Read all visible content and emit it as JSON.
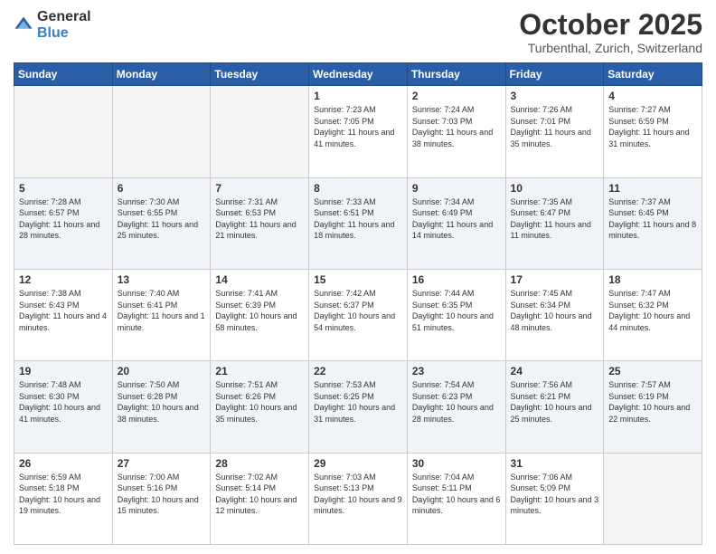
{
  "header": {
    "logo_general": "General",
    "logo_blue": "Blue",
    "month_title": "October 2025",
    "location": "Turbenthal, Zurich, Switzerland"
  },
  "weekdays": [
    "Sunday",
    "Monday",
    "Tuesday",
    "Wednesday",
    "Thursday",
    "Friday",
    "Saturday"
  ],
  "weeks": [
    [
      {
        "day": "",
        "sunrise": "",
        "sunset": "",
        "daylight": ""
      },
      {
        "day": "",
        "sunrise": "",
        "sunset": "",
        "daylight": ""
      },
      {
        "day": "",
        "sunrise": "",
        "sunset": "",
        "daylight": ""
      },
      {
        "day": "1",
        "sunrise": "Sunrise: 7:23 AM",
        "sunset": "Sunset: 7:05 PM",
        "daylight": "Daylight: 11 hours and 41 minutes."
      },
      {
        "day": "2",
        "sunrise": "Sunrise: 7:24 AM",
        "sunset": "Sunset: 7:03 PM",
        "daylight": "Daylight: 11 hours and 38 minutes."
      },
      {
        "day": "3",
        "sunrise": "Sunrise: 7:26 AM",
        "sunset": "Sunset: 7:01 PM",
        "daylight": "Daylight: 11 hours and 35 minutes."
      },
      {
        "day": "4",
        "sunrise": "Sunrise: 7:27 AM",
        "sunset": "Sunset: 6:59 PM",
        "daylight": "Daylight: 11 hours and 31 minutes."
      }
    ],
    [
      {
        "day": "5",
        "sunrise": "Sunrise: 7:28 AM",
        "sunset": "Sunset: 6:57 PM",
        "daylight": "Daylight: 11 hours and 28 minutes."
      },
      {
        "day": "6",
        "sunrise": "Sunrise: 7:30 AM",
        "sunset": "Sunset: 6:55 PM",
        "daylight": "Daylight: 11 hours and 25 minutes."
      },
      {
        "day": "7",
        "sunrise": "Sunrise: 7:31 AM",
        "sunset": "Sunset: 6:53 PM",
        "daylight": "Daylight: 11 hours and 21 minutes."
      },
      {
        "day": "8",
        "sunrise": "Sunrise: 7:33 AM",
        "sunset": "Sunset: 6:51 PM",
        "daylight": "Daylight: 11 hours and 18 minutes."
      },
      {
        "day": "9",
        "sunrise": "Sunrise: 7:34 AM",
        "sunset": "Sunset: 6:49 PM",
        "daylight": "Daylight: 11 hours and 14 minutes."
      },
      {
        "day": "10",
        "sunrise": "Sunrise: 7:35 AM",
        "sunset": "Sunset: 6:47 PM",
        "daylight": "Daylight: 11 hours and 11 minutes."
      },
      {
        "day": "11",
        "sunrise": "Sunrise: 7:37 AM",
        "sunset": "Sunset: 6:45 PM",
        "daylight": "Daylight: 11 hours and 8 minutes."
      }
    ],
    [
      {
        "day": "12",
        "sunrise": "Sunrise: 7:38 AM",
        "sunset": "Sunset: 6:43 PM",
        "daylight": "Daylight: 11 hours and 4 minutes."
      },
      {
        "day": "13",
        "sunrise": "Sunrise: 7:40 AM",
        "sunset": "Sunset: 6:41 PM",
        "daylight": "Daylight: 11 hours and 1 minute."
      },
      {
        "day": "14",
        "sunrise": "Sunrise: 7:41 AM",
        "sunset": "Sunset: 6:39 PM",
        "daylight": "Daylight: 10 hours and 58 minutes."
      },
      {
        "day": "15",
        "sunrise": "Sunrise: 7:42 AM",
        "sunset": "Sunset: 6:37 PM",
        "daylight": "Daylight: 10 hours and 54 minutes."
      },
      {
        "day": "16",
        "sunrise": "Sunrise: 7:44 AM",
        "sunset": "Sunset: 6:35 PM",
        "daylight": "Daylight: 10 hours and 51 minutes."
      },
      {
        "day": "17",
        "sunrise": "Sunrise: 7:45 AM",
        "sunset": "Sunset: 6:34 PM",
        "daylight": "Daylight: 10 hours and 48 minutes."
      },
      {
        "day": "18",
        "sunrise": "Sunrise: 7:47 AM",
        "sunset": "Sunset: 6:32 PM",
        "daylight": "Daylight: 10 hours and 44 minutes."
      }
    ],
    [
      {
        "day": "19",
        "sunrise": "Sunrise: 7:48 AM",
        "sunset": "Sunset: 6:30 PM",
        "daylight": "Daylight: 10 hours and 41 minutes."
      },
      {
        "day": "20",
        "sunrise": "Sunrise: 7:50 AM",
        "sunset": "Sunset: 6:28 PM",
        "daylight": "Daylight: 10 hours and 38 minutes."
      },
      {
        "day": "21",
        "sunrise": "Sunrise: 7:51 AM",
        "sunset": "Sunset: 6:26 PM",
        "daylight": "Daylight: 10 hours and 35 minutes."
      },
      {
        "day": "22",
        "sunrise": "Sunrise: 7:53 AM",
        "sunset": "Sunset: 6:25 PM",
        "daylight": "Daylight: 10 hours and 31 minutes."
      },
      {
        "day": "23",
        "sunrise": "Sunrise: 7:54 AM",
        "sunset": "Sunset: 6:23 PM",
        "daylight": "Daylight: 10 hours and 28 minutes."
      },
      {
        "day": "24",
        "sunrise": "Sunrise: 7:56 AM",
        "sunset": "Sunset: 6:21 PM",
        "daylight": "Daylight: 10 hours and 25 minutes."
      },
      {
        "day": "25",
        "sunrise": "Sunrise: 7:57 AM",
        "sunset": "Sunset: 6:19 PM",
        "daylight": "Daylight: 10 hours and 22 minutes."
      }
    ],
    [
      {
        "day": "26",
        "sunrise": "Sunrise: 6:59 AM",
        "sunset": "Sunset: 5:18 PM",
        "daylight": "Daylight: 10 hours and 19 minutes."
      },
      {
        "day": "27",
        "sunrise": "Sunrise: 7:00 AM",
        "sunset": "Sunset: 5:16 PM",
        "daylight": "Daylight: 10 hours and 15 minutes."
      },
      {
        "day": "28",
        "sunrise": "Sunrise: 7:02 AM",
        "sunset": "Sunset: 5:14 PM",
        "daylight": "Daylight: 10 hours and 12 minutes."
      },
      {
        "day": "29",
        "sunrise": "Sunrise: 7:03 AM",
        "sunset": "Sunset: 5:13 PM",
        "daylight": "Daylight: 10 hours and 9 minutes."
      },
      {
        "day": "30",
        "sunrise": "Sunrise: 7:04 AM",
        "sunset": "Sunset: 5:11 PM",
        "daylight": "Daylight: 10 hours and 6 minutes."
      },
      {
        "day": "31",
        "sunrise": "Sunrise: 7:06 AM",
        "sunset": "Sunset: 5:09 PM",
        "daylight": "Daylight: 10 hours and 3 minutes."
      },
      {
        "day": "",
        "sunrise": "",
        "sunset": "",
        "daylight": ""
      }
    ]
  ]
}
